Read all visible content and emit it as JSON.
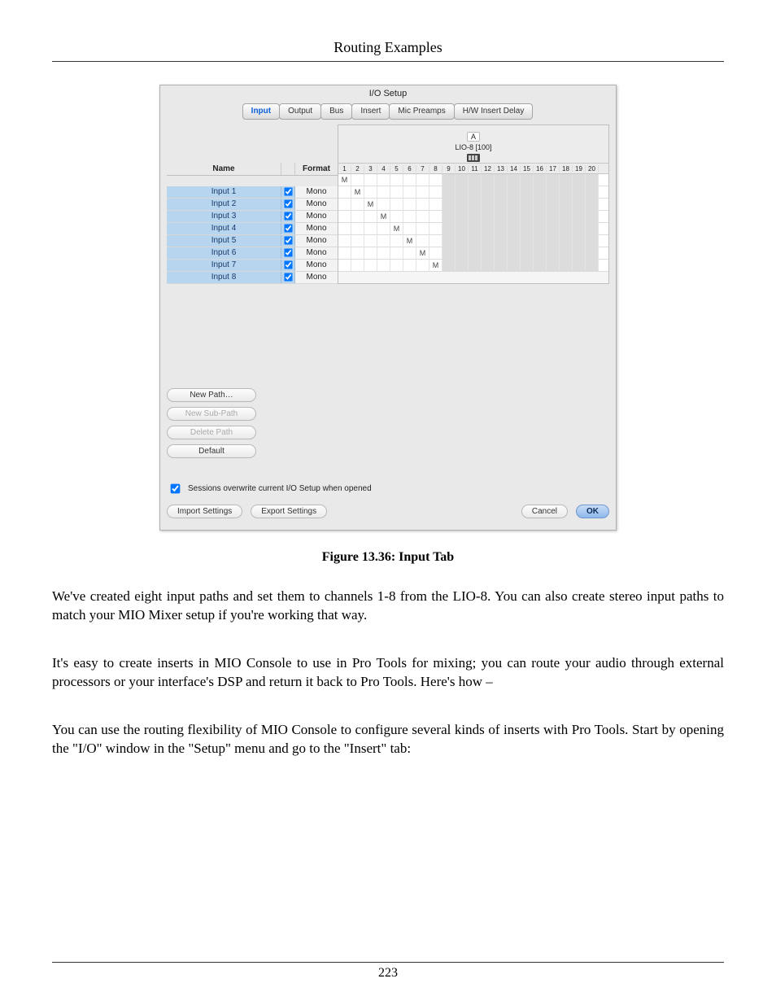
{
  "header": {
    "title": "Routing Examples"
  },
  "figure": {
    "window_title": "I/O Setup",
    "tabs": [
      "Input",
      "Output",
      "Bus",
      "Insert",
      "Mic Preamps",
      "H/W Insert Delay"
    ],
    "active_tab_index": 0,
    "device_slot": "A",
    "device_name": "LIO-8 [100]",
    "columns": {
      "name": "Name",
      "format": "Format"
    },
    "channel_count": 20,
    "paths": [
      {
        "name": "Input 1",
        "checked": true,
        "format": "Mono",
        "channel": 1
      },
      {
        "name": "Input 2",
        "checked": true,
        "format": "Mono",
        "channel": 2
      },
      {
        "name": "Input 3",
        "checked": true,
        "format": "Mono",
        "channel": 3
      },
      {
        "name": "Input 4",
        "checked": true,
        "format": "Mono",
        "channel": 4
      },
      {
        "name": "Input 5",
        "checked": true,
        "format": "Mono",
        "channel": 5
      },
      {
        "name": "Input 6",
        "checked": true,
        "format": "Mono",
        "channel": 6
      },
      {
        "name": "Input 7",
        "checked": true,
        "format": "Mono",
        "channel": 7
      },
      {
        "name": "Input 8",
        "checked": true,
        "format": "Mono",
        "channel": 8
      }
    ],
    "buttons": {
      "new_path": "New Path…",
      "new_subpath": "New Sub-Path",
      "delete_path": "Delete Path",
      "default": "Default"
    },
    "overwrite_label": "Sessions overwrite current I/O Setup when opened",
    "overwrite_checked": true,
    "bottom": {
      "import": "Import Settings",
      "export": "Export Settings",
      "cancel": "Cancel",
      "ok": "OK"
    }
  },
  "caption": "Figure 13.36: Input Tab",
  "paragraphs": {
    "p1": "We've created eight input paths and set them to channels 1-8 from the LIO-8. You can also create stereo input paths to match your MIO Mixer setup if you're working that way.",
    "p2": "It's easy to create inserts in MIO Console to use in Pro Tools for mixing; you can route your audio through external processors or your interface's DSP and return it back to Pro Tools. Here's how –",
    "p3": "You can use the routing flexibility of MIO Console to configure several kinds of inserts with Pro Tools. Start by opening the \"I/O\" window in the \"Setup\" menu and go to the \"Insert\" tab:"
  },
  "page_number": "223"
}
